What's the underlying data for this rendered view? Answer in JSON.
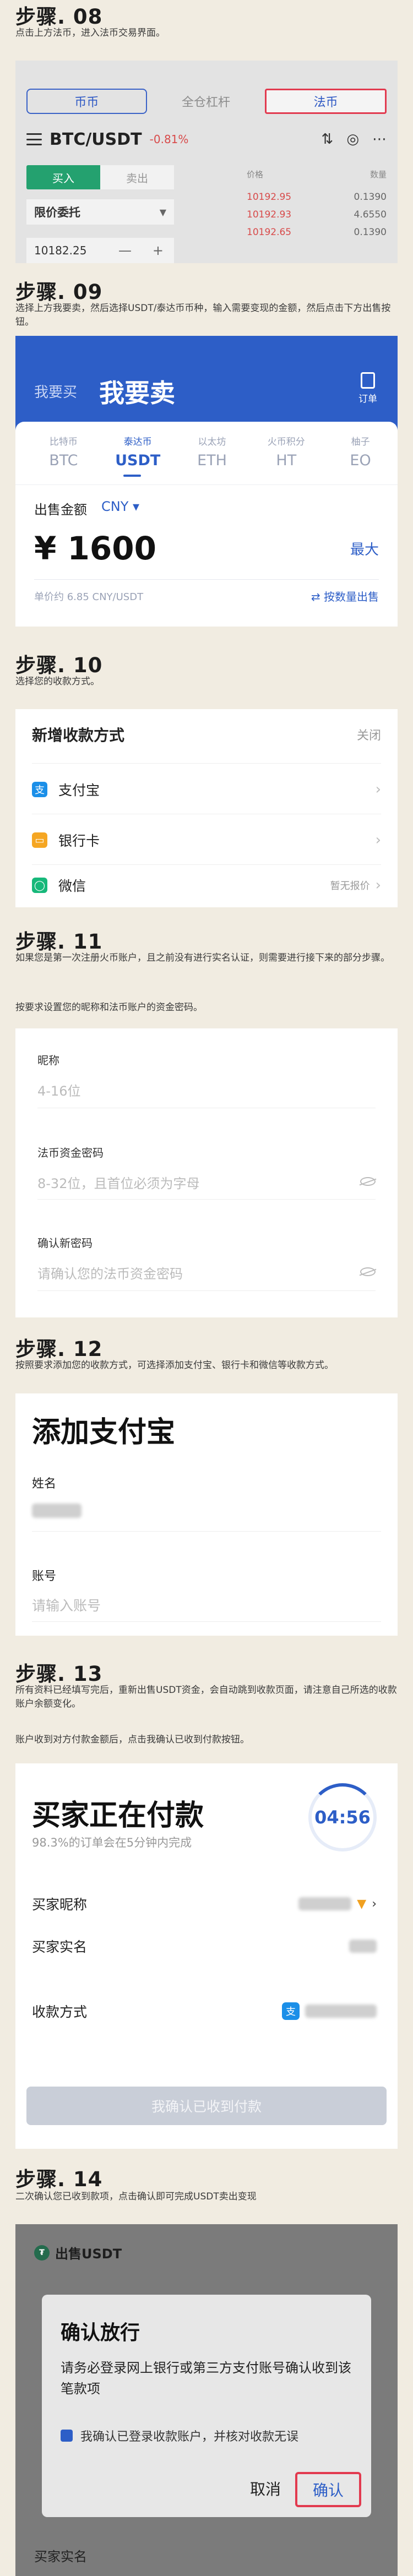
{
  "steps": {
    "s08": {
      "title": "步骤. 08",
      "desc": "点击上方法币，进入法币交易界面。"
    },
    "s09": {
      "title": "步骤. 09",
      "desc": "选择上方我要卖，然后选择USDT/泰达币币种，输入需要变现的金额，然后点击下方出售按钮。"
    },
    "s10": {
      "title": "步骤. 10",
      "desc": "选择您的收款方式。"
    },
    "s11": {
      "title": "步骤. 11",
      "desc": "如果您是第一次注册火币账户，且之前没有进行实名认证，则需要进行接下来的部分步骤。",
      "desc2": "按要求设置您的昵称和法币账户的资金密码。"
    },
    "s12": {
      "title": "步骤. 12",
      "desc": "按照要求添加您的收款方式，可选择添加支付宝、银行卡和微信等收款方式。"
    },
    "s13": {
      "title": "步骤. 13",
      "desc": "所有资料已经填写完后，重新出售USDT资金，会自动跳到收款页面，请注意自己所选的收款账户余额变化。",
      "desc2": "账户收到对方付款金额后，点击我确认已收到付款按钮。"
    },
    "s14": {
      "title": "步骤. 14",
      "desc": "二次确认您已收到款项，点击确认即可完成USDT卖出变现"
    }
  },
  "step08": {
    "tabs": [
      "币币",
      "全仓杠杆",
      "法币"
    ],
    "pair": "BTC/USDT",
    "change": "-0.81%",
    "buy": "买入",
    "sell": "卖出",
    "order_type": "限价委托",
    "price_value": "10182.25",
    "book_head": [
      "价格",
      "数量"
    ],
    "book": [
      {
        "price": "10192.95",
        "qty": "0.1390"
      },
      {
        "price": "10192.93",
        "qty": "4.6550"
      },
      {
        "price": "10192.65",
        "qty": "0.1390"
      }
    ]
  },
  "step09": {
    "buy_tab": "我要买",
    "sell_tab": "我要卖",
    "order_label": "订单",
    "coins": [
      {
        "cn": "比特币",
        "code": "BTC"
      },
      {
        "cn": "泰达币",
        "code": "USDT"
      },
      {
        "cn": "以太坊",
        "code": "ETH"
      },
      {
        "cn": "火币积分",
        "code": "HT"
      },
      {
        "cn": "柚子",
        "code": "EO"
      }
    ],
    "amount_label": "出售金额",
    "currency": "CNY ▾",
    "amount": "¥ 1600",
    "max": "最大",
    "unit_price": "单价约 6.85 CNY/USDT",
    "by_qty": "⇄ 按数量出售"
  },
  "step10": {
    "title": "新增收款方式",
    "close": "关闭",
    "methods": [
      {
        "label": "支付宝",
        "note": "",
        "icon": "alipay-icon",
        "color": "#1b8fe8",
        "glyph": "支"
      },
      {
        "label": "银行卡",
        "note": "",
        "icon": "bank-card-icon",
        "color": "#f5a623",
        "glyph": "▭"
      },
      {
        "label": "微信",
        "note": "暂无报价",
        "icon": "wechat-icon",
        "color": "#17b87a",
        "glyph": "◯"
      }
    ]
  },
  "step11": {
    "nickname_label": "昵称",
    "nickname_ph": "4-16位",
    "pwd_label": "法币资金密码",
    "pwd_ph": "8-32位，且首位必须为字母",
    "confirm_label": "确认新密码",
    "confirm_ph": "请确认您的法币资金密码"
  },
  "step12": {
    "title": "添加支付宝",
    "name_label": "姓名",
    "account_label": "账号",
    "account_ph": "请输入账号"
  },
  "step13": {
    "title": "买家正在付款",
    "sub": "98.3%的订单会在5分钟内完成",
    "timer": "04:56",
    "nickname_label": "买家昵称",
    "realname_label": "买家实名",
    "payment_label": "收款方式",
    "confirm_btn": "我确认已收到付款"
  },
  "step14": {
    "header": "出售USDT",
    "bg_label": "买家实名",
    "dialog_title": "确认放行",
    "dialog_text": "请务必登录网上银行或第三方支付账号确认收到该笔款项",
    "check_text": "我确认已登录收款账户，并核对收款无误",
    "cancel": "取消",
    "confirm": "确认"
  },
  "colors": {
    "accent": "#2d5ec7",
    "highlight": "#e23a4f",
    "page_bg": "#f1ece1"
  }
}
